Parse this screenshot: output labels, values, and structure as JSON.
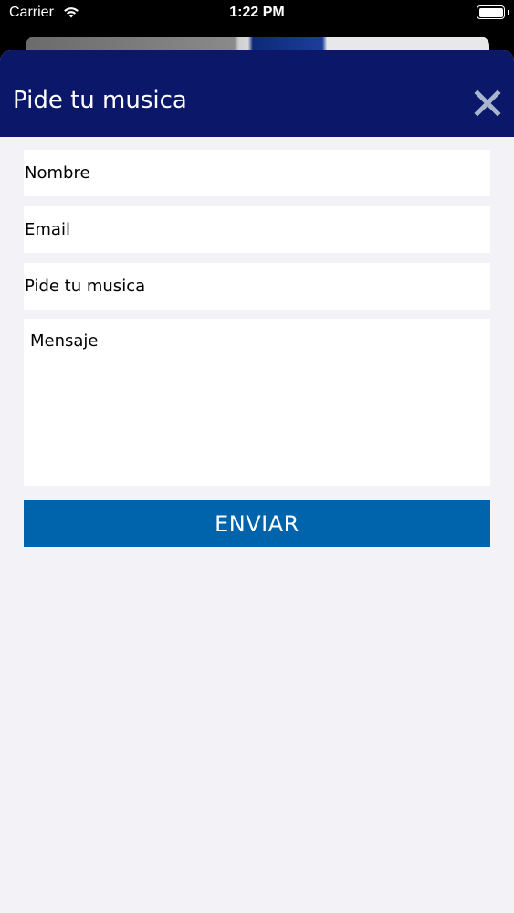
{
  "status_bar": {
    "carrier": "Carrier",
    "time": "1:22 PM",
    "wifi_icon": "wifi-icon",
    "battery_icon": "battery-icon"
  },
  "sheet": {
    "title": "Pide tu musica",
    "close_icon": "close-icon"
  },
  "form": {
    "name_placeholder": "Nombre",
    "email_placeholder": "Email",
    "song_placeholder": "Pide tu musica",
    "message_placeholder": "Mensaje",
    "submit_label": "ENVIAR"
  },
  "colors": {
    "header_bg": "#0b1869",
    "submit_bg": "#0064ac",
    "page_bg": "#f2f2f7",
    "close_icon": "#a9b4cf"
  }
}
